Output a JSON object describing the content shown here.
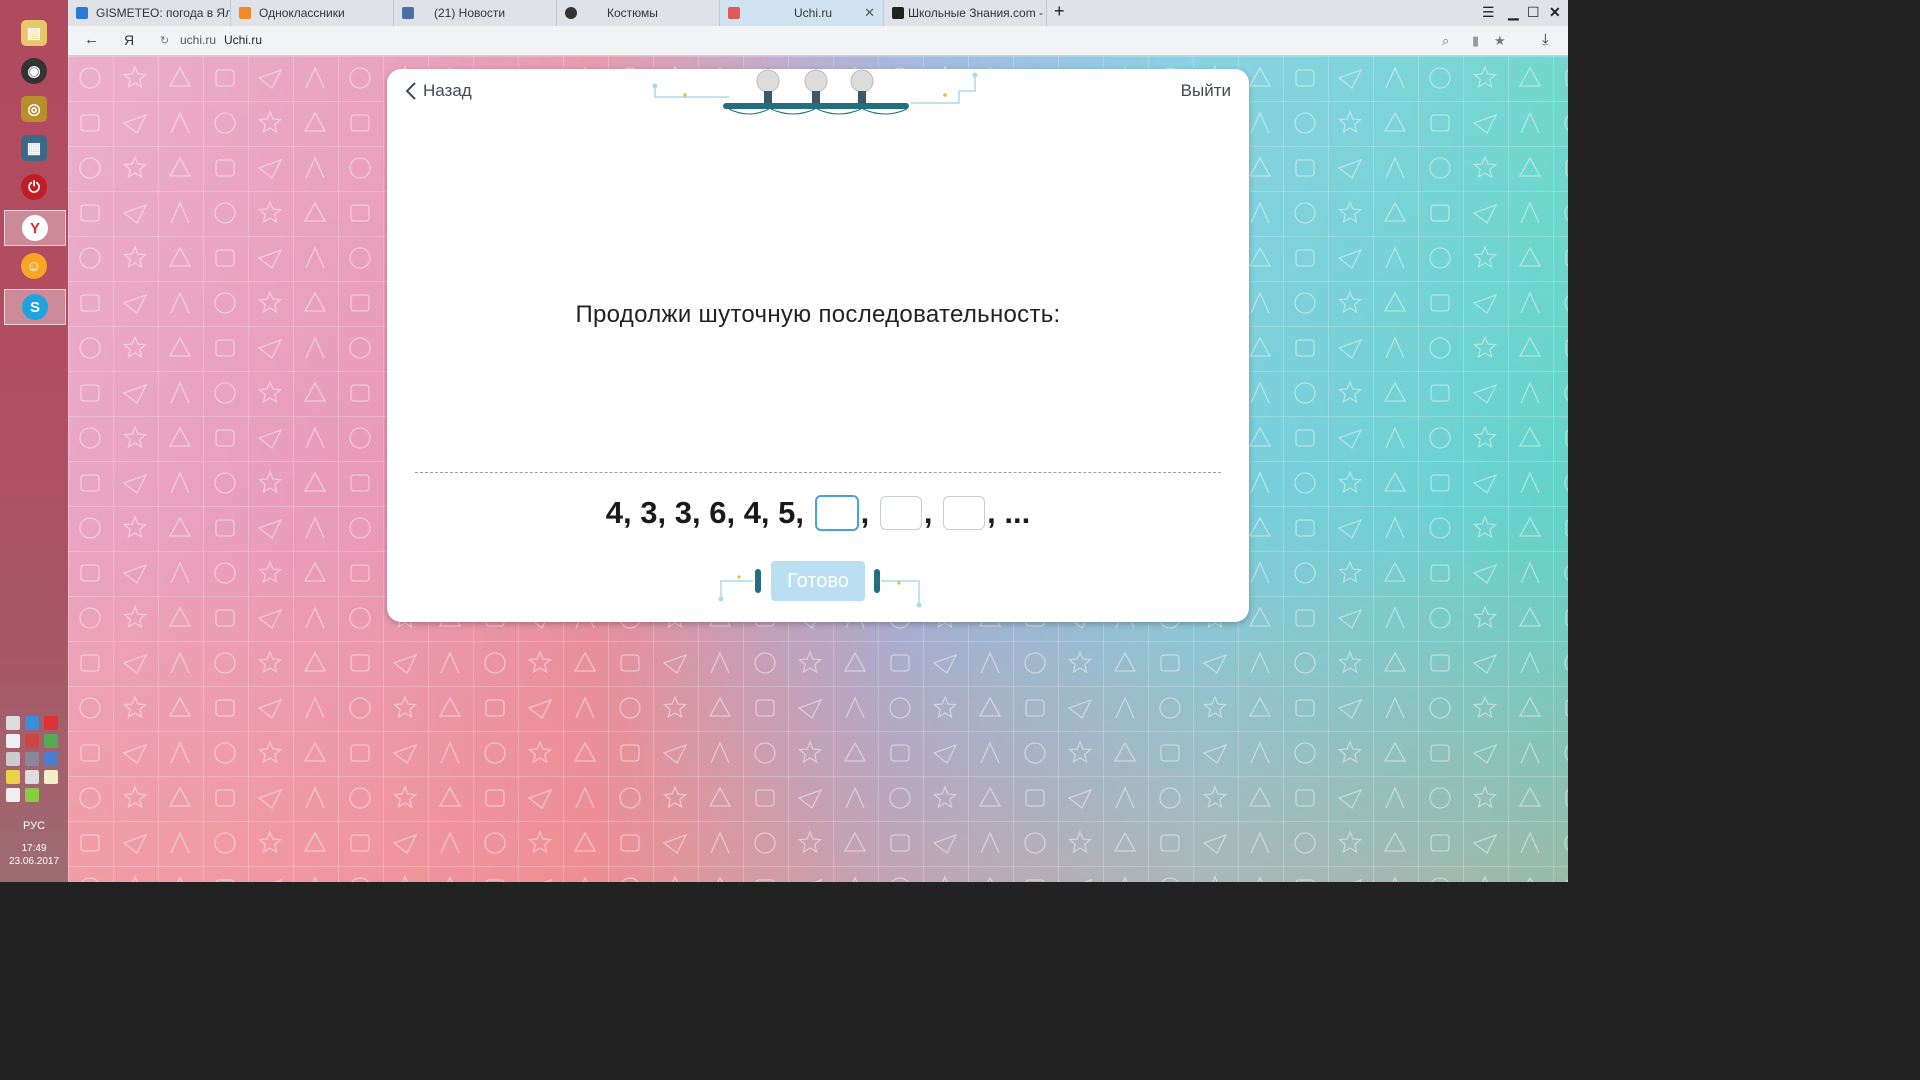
{
  "taskbar": {
    "apps": [
      "files-icon",
      "speaker-icon",
      "webcam-icon",
      "photo-icon",
      "power-icon",
      "yandex-browser-icon",
      "smile-icon",
      "skype-icon"
    ],
    "lang": "РУС",
    "time": "17:49",
    "date": "23.06.2017"
  },
  "tabs": [
    {
      "title": "GISMETEO: погода в Ялутор",
      "fav_color": "#2b7bd6"
    },
    {
      "title": "Одноклассники",
      "fav_color": "#f08a24"
    },
    {
      "title": "(21) Новости",
      "fav_color": "#4a6fa5"
    },
    {
      "title": "Костюмы",
      "fav_color": "#333333"
    },
    {
      "title": "Uchi.ru",
      "fav_color": "#e05a5a"
    },
    {
      "title": "Школьные Знания.com - Ре",
      "fav_color": "#222222"
    }
  ],
  "address": {
    "host": "uchi.ru",
    "title": "Uchi.ru",
    "logo": "Я"
  },
  "card": {
    "back_label": "Назад",
    "exit_label": "Выйти",
    "question": "Продолжи шуточную последовательность:",
    "sequence": [
      "4,",
      "3,",
      "3,",
      "6,",
      "4,",
      "5,"
    ],
    "separators": [
      ",",
      ",",
      ", ..."
    ],
    "done_label": "Готово"
  },
  "colors": {
    "accent": "#4aa3d8",
    "done_button": "#b9dff0",
    "text": "#3e4a57"
  }
}
